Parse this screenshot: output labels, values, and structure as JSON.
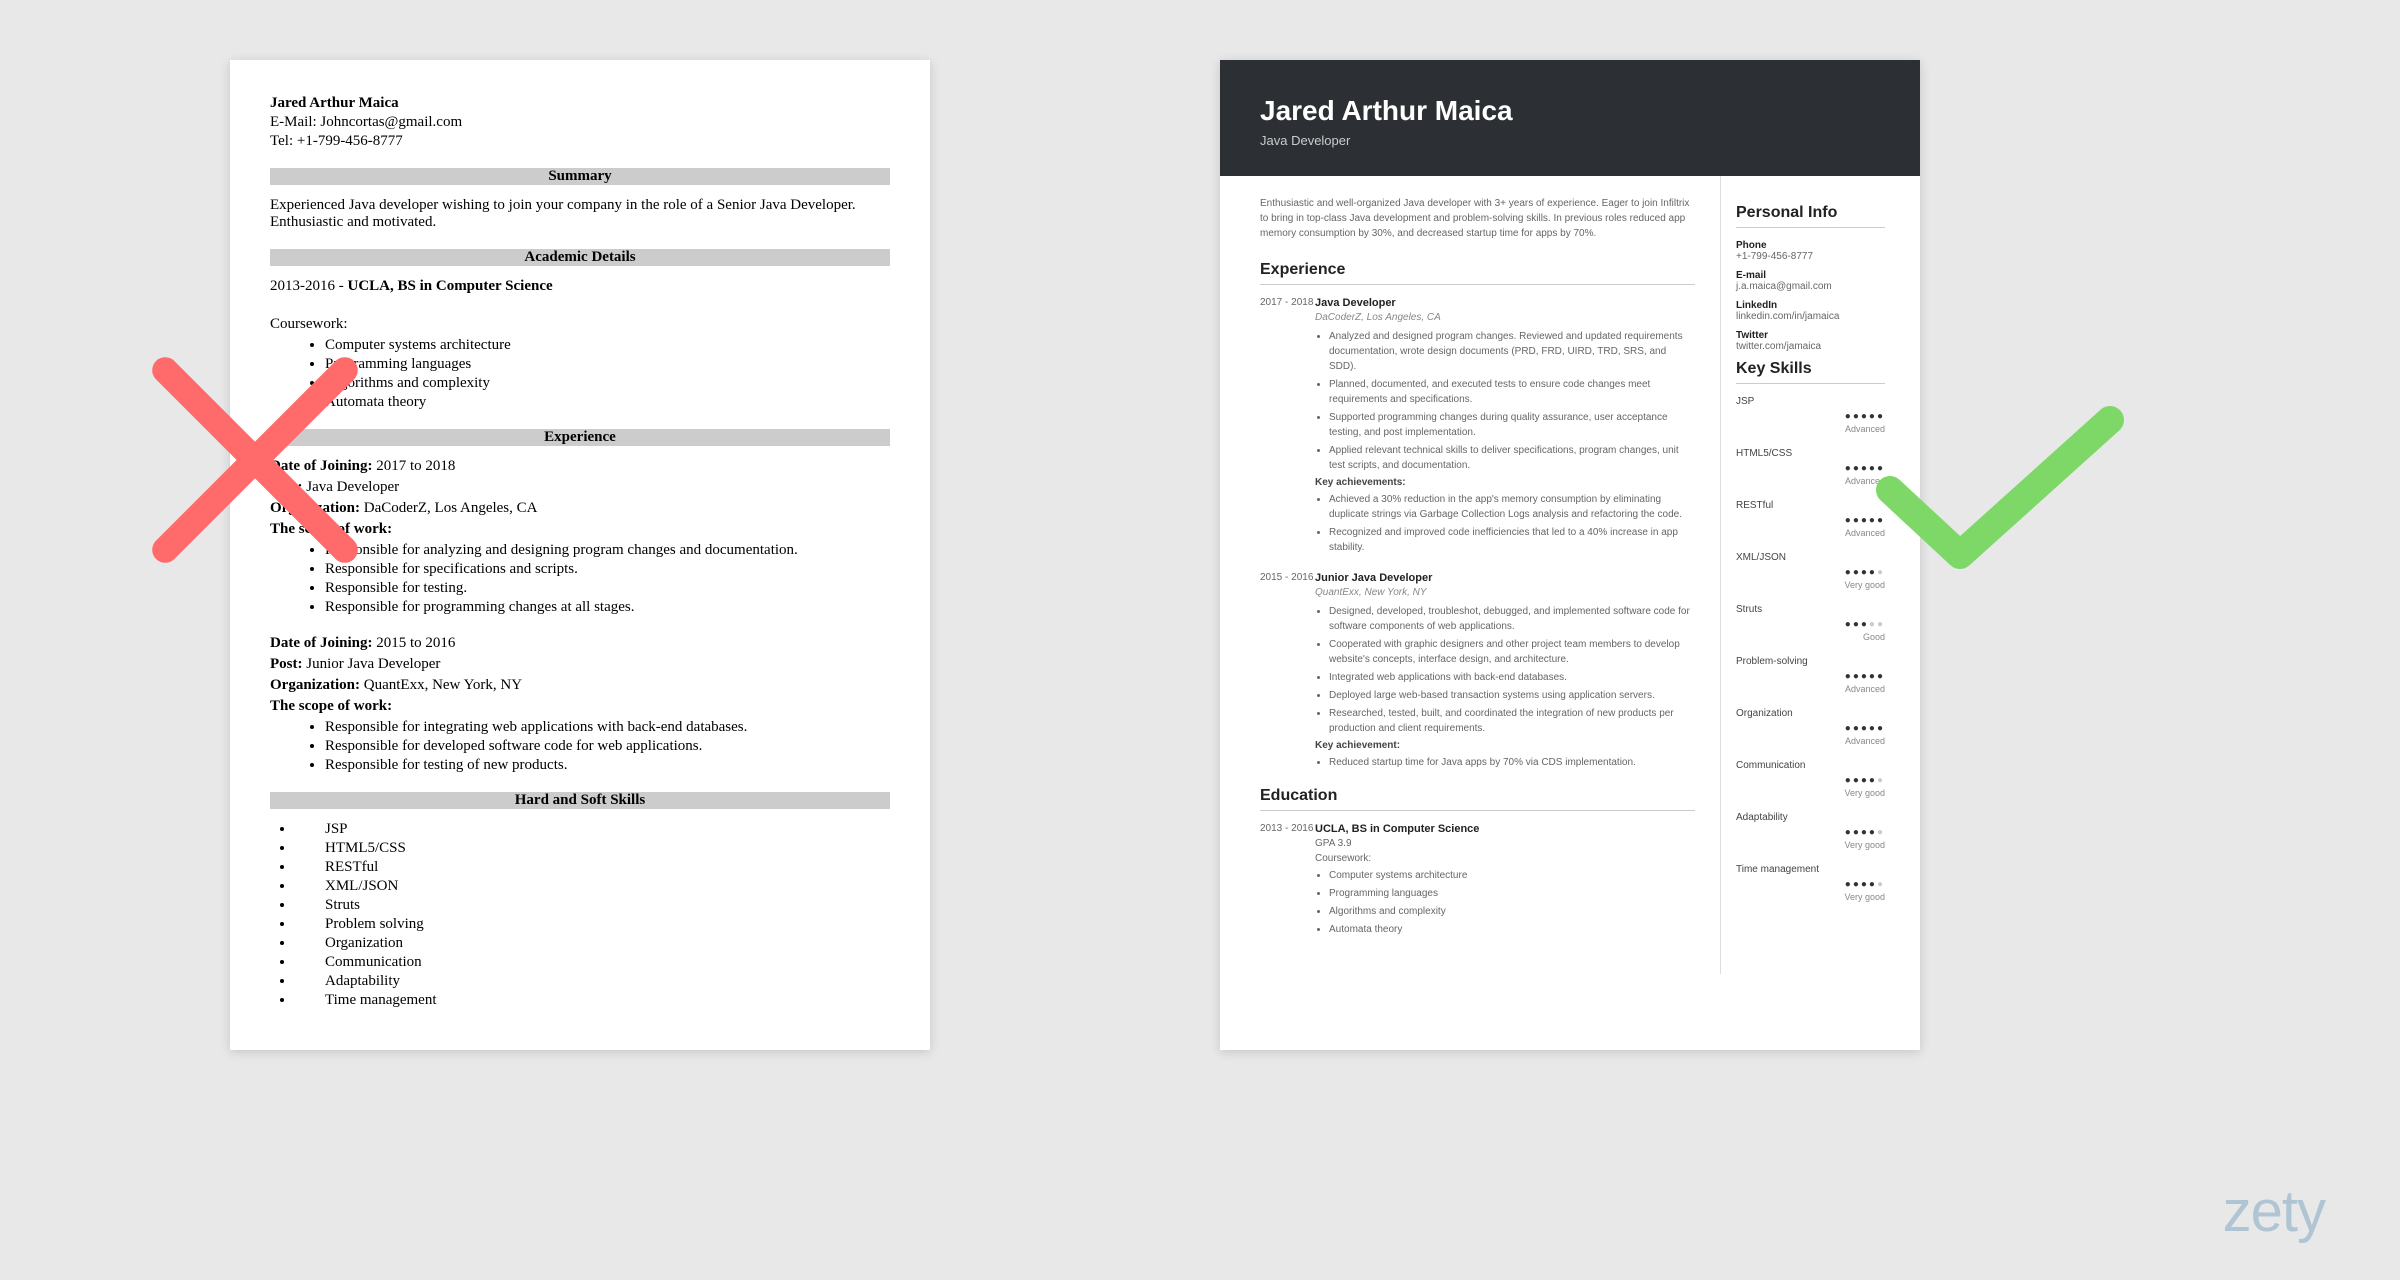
{
  "brand": "zety",
  "left": {
    "name": "Jared Arthur Maica",
    "email_label": "E-Mail: Johncortas@gmail.com",
    "tel_label": "Tel: +1-799-456-8777",
    "summary_heading": "Summary",
    "summary_text": "Experienced Java developer wishing to join your company in the role of a Senior Java Developer. Enthusiastic and motivated.",
    "academic_heading": "Academic Details",
    "academic_range": "2013-2016 - ",
    "academic_degree": "UCLA, BS in Computer Science",
    "coursework_label": "Coursework:",
    "coursework": [
      "Computer systems architecture",
      "Programming languages",
      "Algorithms and complexity",
      "Automata theory"
    ],
    "experience_heading": "Experience",
    "job1": {
      "doj_label": "Date of Joining:",
      "doj": " 2017 to 2018",
      "post_label": "Post:",
      "post": " Java Developer",
      "org_label": "Organization:",
      "org": " DaCoderZ, Los Angeles, CA",
      "scope_label": "The scope of work:",
      "bullets": [
        "Responsible for analyzing and designing program changes and documentation.",
        "Responsible for specifications and scripts.",
        "Responsible for testing.",
        "Responsible for programming changes at all stages."
      ]
    },
    "job2": {
      "doj_label": "Date of Joining:",
      "doj": " 2015 to 2016",
      "post_label": "Post:",
      "post": " Junior Java Developer",
      "org_label": "Organization:",
      "org": " QuantExx, New York, NY",
      "scope_label": "The scope of work:",
      "bullets": [
        "Responsible for integrating web applications with back-end databases.",
        "Responsible for developed software code for web applications.",
        "Responsible for testing of new products."
      ]
    },
    "skills_heading": "Hard and Soft Skills",
    "skills": [
      "JSP",
      "HTML5/CSS",
      "RESTful",
      "XML/JSON",
      "Struts",
      "Problem solving",
      "Organization",
      "Communication",
      "Adaptability",
      "Time management"
    ]
  },
  "right": {
    "name": "Jared Arthur Maica",
    "title": "Java Developer",
    "summary": "Enthusiastic and well-organized Java developer with 3+ years of experience. Eager to join Infiltrix to bring in top-class Java development and problem-solving skills. In previous roles reduced app memory consumption by 30%, and decreased startup time for apps by 70%.",
    "experience_heading": "Experience",
    "jobs": [
      {
        "dates": "2017 - 2018",
        "title": "Java Developer",
        "company": "DaCoderZ, Los Angeles, CA",
        "bullets": [
          "Analyzed and designed program changes. Reviewed and updated requirements documentation, wrote design documents (PRD, FRD, UIRD, TRD, SRS, and SDD).",
          "Planned, documented, and executed tests to ensure code changes meet requirements and specifications.",
          "Supported programming changes during quality assurance, user acceptance testing, and post implementation.",
          "Applied relevant technical skills to deliver specifications, program changes, unit test scripts, and documentation."
        ],
        "key_label": "Key achievements:",
        "key_bullets": [
          "Achieved a 30% reduction in the app's memory consumption by eliminating duplicate strings via Garbage Collection Logs analysis and refactoring the code.",
          "Recognized and improved code inefficiencies that led to a 40% increase in app stability."
        ]
      },
      {
        "dates": "2015 - 2016",
        "title": "Junior Java Developer",
        "company": "QuantExx, New York, NY",
        "bullets": [
          "Designed, developed, troubleshot, debugged, and implemented software code for software components of web applications.",
          "Cooperated with graphic designers and other project team members to develop website's concepts, interface design, and architecture.",
          "Integrated web applications with back-end databases.",
          "Deployed large web-based transaction systems using application servers.",
          "Researched, tested, built, and coordinated the integration of new products per production and client requirements."
        ],
        "key_label": "Key achievement:",
        "key_bullets": [
          "Reduced startup time for Java apps by 70% via CDS implementation."
        ]
      }
    ],
    "education_heading": "Education",
    "education": {
      "dates": "2013 - 2016",
      "degree": "UCLA, BS in Computer Science",
      "gpa": "GPA 3.9",
      "coursework_label": "Coursework:",
      "coursework": [
        "Computer systems architecture",
        "Programming languages",
        "Algorithms and complexity",
        "Automata theory"
      ]
    },
    "personal_heading": "Personal Info",
    "info": [
      {
        "label": "Phone",
        "value": "+1-799-456-8777"
      },
      {
        "label": "E-mail",
        "value": "j.a.maica@gmail.com"
      },
      {
        "label": "LinkedIn",
        "value": "linkedin.com/in/jamaica"
      },
      {
        "label": "Twitter",
        "value": "twitter.com/jamaica"
      }
    ],
    "skills_heading": "Key Skills",
    "skills": [
      {
        "name": "JSP",
        "rating": 5,
        "level": "Advanced"
      },
      {
        "name": "HTML5/CSS",
        "rating": 5,
        "level": "Advanced"
      },
      {
        "name": "RESTful",
        "rating": 5,
        "level": "Advanced"
      },
      {
        "name": "XML/JSON",
        "rating": 4,
        "level": "Very good"
      },
      {
        "name": "Struts",
        "rating": 3,
        "level": "Good"
      },
      {
        "name": "Problem-solving",
        "rating": 5,
        "level": "Advanced"
      },
      {
        "name": "Organization",
        "rating": 5,
        "level": "Advanced"
      },
      {
        "name": "Communication",
        "rating": 4,
        "level": "Very good"
      },
      {
        "name": "Adaptability",
        "rating": 4,
        "level": "Very good"
      },
      {
        "name": "Time management",
        "rating": 4,
        "level": "Very good"
      }
    ]
  }
}
